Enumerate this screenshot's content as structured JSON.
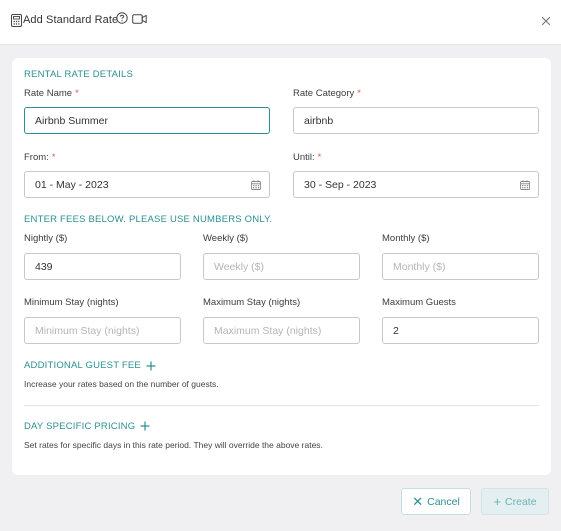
{
  "header": {
    "title": "Add Standard Rate"
  },
  "rental_details": {
    "section_title": "RENTAL RATE DETAILS",
    "rate_name_label": "Rate Name",
    "rate_name_value": "Airbnb Summer",
    "rate_category_label": "Rate Category",
    "rate_category_value": "airbnb",
    "from_label": "From:",
    "from_value": "01 - May - 2023",
    "until_label": "Until:",
    "until_value": "30 - Sep - 2023",
    "required_marker": "*"
  },
  "fees": {
    "section_title": "ENTER FEES BELOW. PLEASE USE NUMBERS ONLY.",
    "nightly_label": "Nightly ($)",
    "nightly_value": "439",
    "weekly_label": "Weekly ($)",
    "weekly_placeholder": "Weekly ($)",
    "monthly_label": "Monthly ($)",
    "monthly_placeholder": "Monthly ($)",
    "min_stay_label": "Minimum Stay (nights)",
    "min_stay_placeholder": "Minimum Stay (nights)",
    "max_stay_label": "Maximum Stay (nights)",
    "max_stay_placeholder": "Maximum Stay (nights)",
    "max_guests_label": "Maximum Guests",
    "max_guests_value": "2"
  },
  "additional_guest_fee": {
    "title": "ADDITIONAL GUEST FEE",
    "description": "Increase your rates based on the number of guests."
  },
  "day_specific": {
    "title": "DAY SPECIFIC PRICING",
    "description": "Set rates for specific days in this rate period. They will override the above rates."
  },
  "footer": {
    "cancel_label": "Cancel",
    "create_label": "Create"
  },
  "icons": {
    "calculator": "calculator-icon",
    "help": "help-circle-icon",
    "video": "video-icon",
    "close": "close-icon",
    "calendar": "calendar-icon",
    "plus": "plus-icon"
  },
  "colors": {
    "accent": "#2d8f92",
    "required": "#e05a4a",
    "background": "#f0f0f2"
  }
}
